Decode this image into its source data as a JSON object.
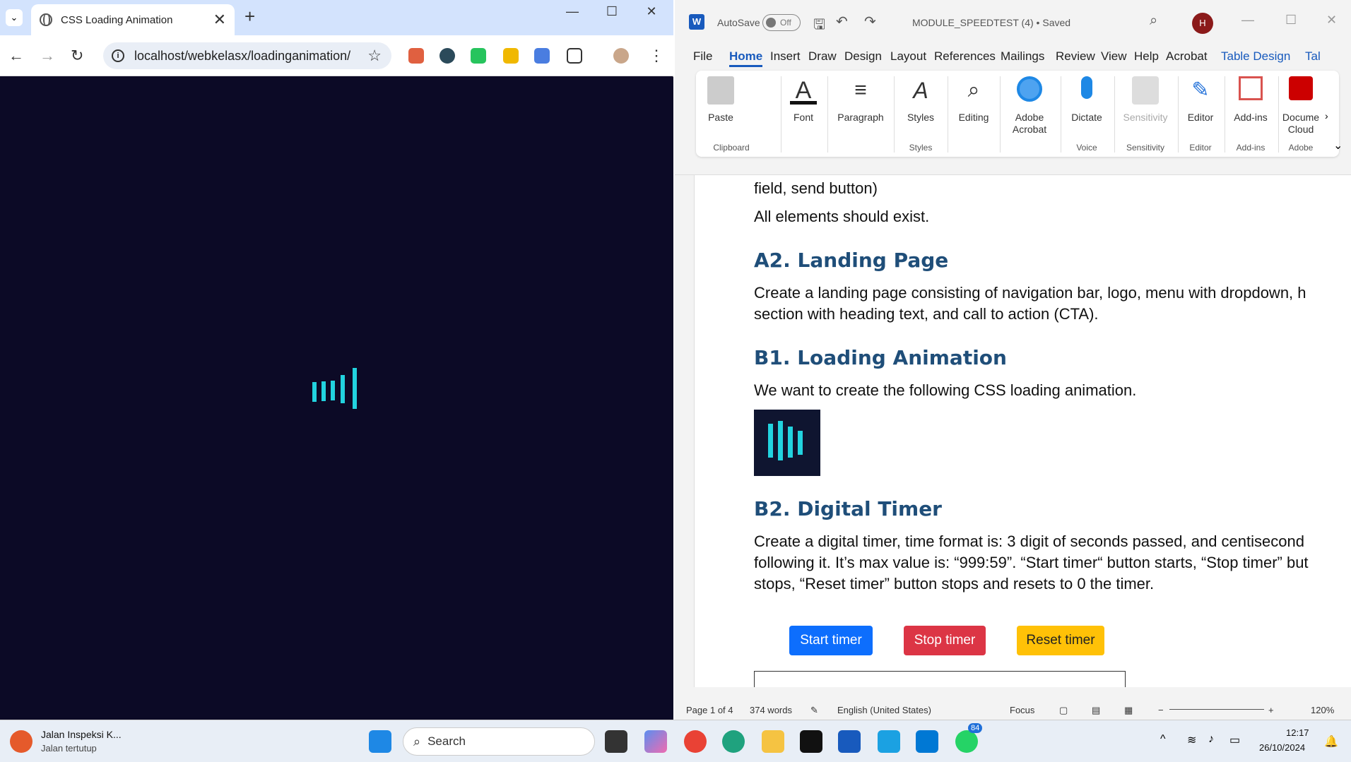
{
  "chrome": {
    "tab_title": "CSS Loading Animation",
    "url": "localhost/webkelasx/loadinganimation/",
    "loader_color": "#22d3df",
    "bg_color": "#0c0a26"
  },
  "word": {
    "autosave_label": "AutoSave",
    "autosave_state": "Off",
    "doc_title": "MODULE_SPEEDTEST (4) • Saved",
    "avatar": "H",
    "menu": [
      "File",
      "Home",
      "Insert",
      "Draw",
      "Design",
      "Layout",
      "References",
      "Mailings",
      "Review",
      "View",
      "Help",
      "Acrobat",
      "Table Design",
      "Tal"
    ],
    "ribbon": {
      "paste": "Paste",
      "clipboard": "Clipboard",
      "font": "Font",
      "paragraph": "Paragraph",
      "styles": "Styles",
      "styles_group": "Styles",
      "editing": "Editing",
      "adobe_acrobat": "Adobe Acrobat",
      "dictate": "Dictate",
      "voice": "Voice",
      "sensitivity": "Sensitivity",
      "sensitivity_group": "Sensitivity",
      "editor": "Editor",
      "editor_group": "Editor",
      "addins": "Add-ins",
      "addins_group": "Add-ins",
      "document_cloud": "Docume Cloud",
      "adobe_group": "Adobe"
    },
    "doc": {
      "line0": "field, send button)",
      "line1": "All elements should exist.",
      "h_a2": "A2. Landing Page",
      "a2_1": "Create a landing page consisting of navigation bar, logo, menu with dropdown, h",
      "a2_2": "section with heading text, and call to action (CTA).",
      "h_b1": "B1. Loading Animation",
      "b1_1": "We want to create the following CSS loading animation.",
      "h_b2": "B2. Digital Timer",
      "b2_1": "Create a digital timer, time format is: 3 digit of seconds passed, and centisecond",
      "b2_2": "following it. It’s max value is: “999:59”. “Start timer“ button starts, “Stop timer” but",
      "b2_3": "stops, “Reset timer” button stops and resets to 0 the timer.",
      "btn_start": "Start timer",
      "btn_stop": "Stop timer",
      "btn_reset": "Reset timer"
    },
    "status": {
      "page": "Page 1 of 4",
      "words": "374 words",
      "lang": "English (United States)",
      "focus": "Focus",
      "zoom": "120%"
    }
  },
  "taskbar": {
    "weather_title": "Jalan Inspeksi K...",
    "weather_sub": "Jalan tertutup",
    "search": "Search",
    "time": "12:17",
    "date": "26/10/2024",
    "whatsapp_badge": "84"
  }
}
